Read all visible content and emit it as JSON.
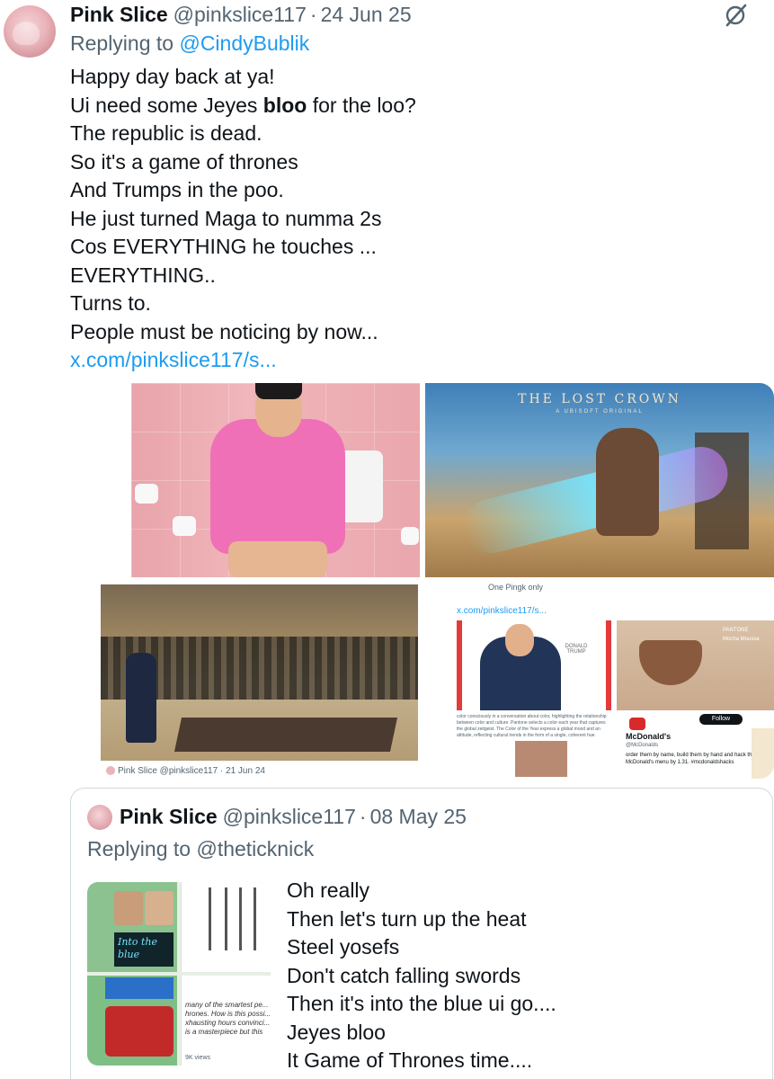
{
  "post": {
    "author_name": "Pink Slice",
    "handle": "@pinkslice117",
    "separator": "·",
    "date": "24 Jun 25",
    "replying_prefix": "Replying to",
    "replying_to": "@CindyBublik",
    "grok_icon": "grok-slash-circle-icon",
    "text_lines": [
      {
        "pre": "Happy day back at ya!",
        "bold": "",
        "post": ""
      },
      {
        "pre": "Ui need some Jeyes ",
        "bold": "bloo",
        "post": " for the loo?"
      },
      {
        "pre": "The republic is dead.",
        "bold": "",
        "post": ""
      },
      {
        "pre": "So it's a game of thrones",
        "bold": "",
        "post": ""
      },
      {
        "pre": "And Trumps in the poo.",
        "bold": "",
        "post": ""
      },
      {
        "pre": "He just turned Maga to numma 2s",
        "bold": "",
        "post": ""
      },
      {
        "pre": "Cos EVERYTHING he touches ...",
        "bold": "",
        "post": ""
      },
      {
        "pre": "EVERYTHING..",
        "bold": "",
        "post": ""
      },
      {
        "pre": "Turns to.",
        "bold": "",
        "post": ""
      },
      {
        "pre": "People must be noticing by now...",
        "bold": "",
        "post": ""
      }
    ],
    "link": "x.com/pinkslice117/s..."
  },
  "media": {
    "game_title": "THE LOST CROWN",
    "game_subtitle": "A UBISOFT ORIGINAL",
    "lobby_caption": "Pink Slice @pinkslice117 · 21 Jun 24",
    "collage_top": "One Pingk only",
    "collage_url": "x.com/pinkslice117/s...",
    "magazine_title": "DONALD TRUMP",
    "pantone_label": "PANTONE",
    "pantone_color": "Mocha Mousse",
    "article_text": "color consciously in a conversation about color, highlighting the relationship between color and culture. Pantone selects a color each year that captures the global zeitgeist. The Color of the Year express a global mood and an attitude, reflecting cultural trends in the form of a single, coherent hue.",
    "mcd_name": "McDonald's",
    "mcd_handle": "@McDonalds",
    "mcd_follow": "Follow",
    "mcd_body": "order them by name, build them by hand and hack the McDonald's menu by 1.31. #mcdonaldshacks"
  },
  "quote": {
    "author_name": "Pink Slice",
    "handle": "@pinkslice117",
    "separator": "·",
    "date": "08 May 25",
    "replying_prefix": "Replying to",
    "replying_to": "@theticknick",
    "neon_text": "Into the blue",
    "thumb_text": "many of the smartest pe... hrones. How is this possi... xhausting hours convinci... is a masterpiece but this",
    "thumb_views": "9K views",
    "text_lines": [
      "Oh really",
      "Then let's turn up the heat",
      "Steel yosefs",
      "Don't catch falling swords",
      "Then it's into the blue ui go....",
      "Jeyes bloo",
      "It Game of Thrones time...."
    ]
  }
}
